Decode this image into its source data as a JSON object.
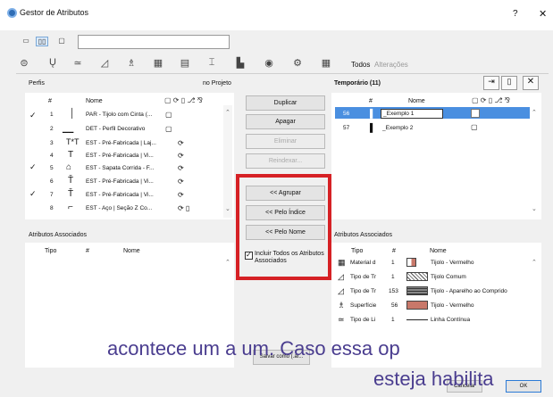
{
  "window": {
    "title": "Gestor de Atributos",
    "help": "?",
    "close": "✕"
  },
  "toolbar": {
    "tabs_todos": "Todos",
    "tabs_alteracoes": "Alterações"
  },
  "left": {
    "title": "Perfis",
    "right_title": "no Projeto",
    "col_num": "#",
    "col_nome": "Nome",
    "rows": [
      {
        "check": "✓",
        "num": "1",
        "nome": "PAR - Tijolo com Cinta (..."
      },
      {
        "check": "",
        "num": "2",
        "nome": "DET - Perfil Decorativo"
      },
      {
        "check": "",
        "num": "3",
        "nome": "EST - Pré-Fabricada | Laj..."
      },
      {
        "check": "",
        "num": "4",
        "nome": "EST - Pré-Fabricada | Vi..."
      },
      {
        "check": "✓",
        "num": "5",
        "nome": "EST - Sapata Corrida - F..."
      },
      {
        "check": "",
        "num": "6",
        "nome": "EST - Pré-Fabricada | Vi..."
      },
      {
        "check": "✓",
        "num": "7",
        "nome": "EST - Pré-Fabricada | Vi..."
      },
      {
        "check": "",
        "num": "8",
        "nome": "EST - Aço | Seção Z Co..."
      }
    ],
    "assoc_title": "Atributos Associados",
    "assoc_tipo": "Tipo",
    "assoc_num": "#",
    "assoc_nome": "Nome"
  },
  "middle": {
    "duplicar": "Duplicar",
    "apagar": "Apagar",
    "eliminar": "Eliminar",
    "reindexar": "Reindexar...",
    "agrupar": "<< Agrupar",
    "pelo_indice": "<< Pelo Índice",
    "pelo_nome": "<< Pelo Nome",
    "incluir": "Incluir Todos os Atributos Associados",
    "salvar": "Salvar como (.ar..."
  },
  "right": {
    "title": "Temporário (11)",
    "col_num": "#",
    "col_nome": "Nome",
    "rows": [
      {
        "num": "56",
        "nome": "_Exemplo 1"
      },
      {
        "num": "57",
        "nome": "_Exemplo 2"
      }
    ],
    "assoc_title": "Atributos Associados",
    "assoc_tipo": "Tipo",
    "assoc_num": "#",
    "assoc_nome": "Nome",
    "assoc_rows": [
      {
        "tipo": "Material d",
        "num": "1",
        "nome": "Tijolo - Vermelho",
        "color": "#c8786a"
      },
      {
        "tipo": "Tipo de Tr",
        "num": "1",
        "nome": "Tijolo Comum",
        "color": "#ffffff"
      },
      {
        "tipo": "Tipo de Tr",
        "num": "153",
        "nome": "Tijolo - Aparelho ao Comprido",
        "color": "#555555"
      },
      {
        "tipo": "Superfície",
        "num": "56",
        "nome": "Tijolo - Vermelho",
        "color": "#c8786a"
      },
      {
        "tipo": "Tipo de Li",
        "num": "1",
        "nome": "Linha Contínua",
        "color": "none"
      }
    ]
  },
  "footer": {
    "cancelar": "Cancelar",
    "ok": "OK"
  },
  "overlay": {
    "line1": "acontece um a um. Caso essa op",
    "line2": "esteja habilita"
  }
}
